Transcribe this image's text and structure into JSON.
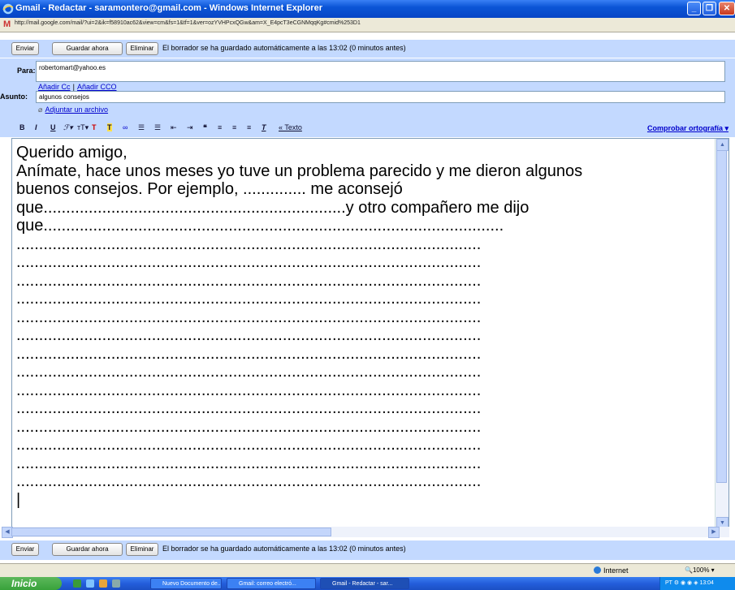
{
  "window": {
    "title": "Gmail - Redactar - saramontero@gmail.com - Windows Internet Explorer",
    "url": "http://mail.google.com/mail/?ui=2&ik=f58910ac62&view=cm&fs=1&tf=1&ver=ozYVHPcxQGw&am=X_E4pcT3eCGNMqqKg#cmid%253D1"
  },
  "top_actions": {
    "send_label": "Enviar",
    "save_label": "Guardar ahora",
    "discard_label": "Eliminar",
    "status": "El borrador se ha guardado automáticamente a las 13:02 (0 minutos antes)"
  },
  "compose": {
    "to_label": "Para:",
    "to_value": "robertomart@yahoo.es",
    "add_cc": "Añadir Cc",
    "separator": "|",
    "add_bcc": "Añadir CCO",
    "subject_label": "Asunto:",
    "subject_value": "algunos consejos",
    "attach_label": "Adjuntar un archivo"
  },
  "toolbar": {
    "icons": [
      "bold-icon",
      "italic-icon",
      "underline-icon",
      "font-icon",
      "font-size-icon",
      "text-color-icon",
      "highlight-color-icon",
      "link-icon",
      "numbered-list-icon",
      "bulleted-list-icon",
      "indent-less-icon",
      "indent-more-icon",
      "quote-icon",
      "align-left-icon",
      "align-center-icon",
      "align-right-icon",
      "remove-formatting-icon"
    ],
    "plain_text_link": "« Texto",
    "spellcheck_label": "Comprobar ortografía ▾"
  },
  "body_text": "Querido amigo,\nAnímate, hace unos meses yo tuve un problema parecido y me dieron algunos\nbuenos consejos. Por ejemplo, .............. me aconsejó\nque...................................................................y otro compañero me dijo\nque......................................................................................................\n.......................................................................................................\n.......................................................................................................\n.......................................................................................................\n.......................................................................................................\n.......................................................................................................\n.......................................................................................................\n.......................................................................................................\n.......................................................................................................\n.......................................................................................................\n.......................................................................................................\n.......................................................................................................\n.......................................................................................................\n.......................................................................................................\n.......................................................................................................\n|",
  "bottom_actions": {
    "send_label": "Enviar",
    "save_label": "Guardar ahora",
    "discard_label": "Eliminar",
    "status": "El borrador se ha guardado automáticamente a las 13:02 (0 minutos antes)"
  },
  "statusbar": {
    "zone": "Internet",
    "zoom": "100%"
  },
  "taskbar": {
    "start_label": "Inicio",
    "tasks": [
      "Nuevo Documento de...",
      "Gmail: correo electró...",
      "Gmail - Redactar - sar..."
    ],
    "clock": "13:04",
    "lang": "PT"
  },
  "colors": {
    "gmail_blue": "#c3d9ff",
    "link": "#0000cc",
    "titlebar": "#0b55d6"
  }
}
